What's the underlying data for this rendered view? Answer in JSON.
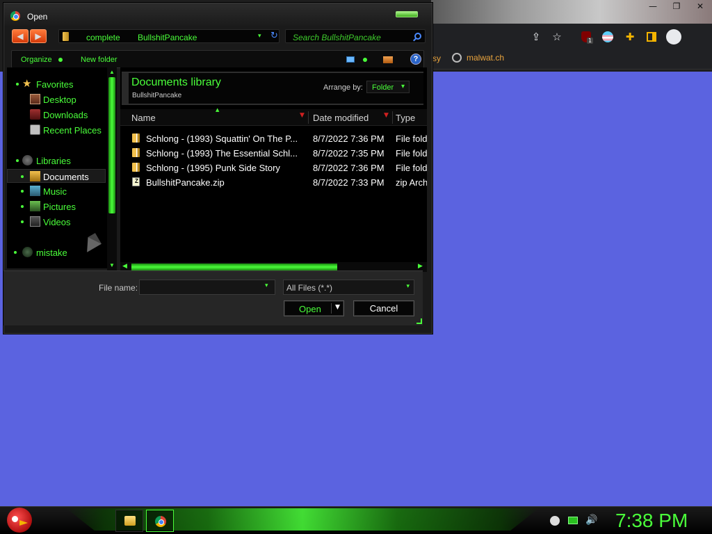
{
  "chrome": {
    "window_controls": {
      "minimize": "—",
      "maximize": "❐",
      "close": "✕"
    },
    "toolbar_icons": [
      "share-icon",
      "star-icon",
      "ublock-icon",
      "profile-switch-icon",
      "extensions-icon",
      "sidepanel-icon",
      "account-icon"
    ],
    "ublock_badge": "1",
    "bookmarks": {
      "partial_item": "sy",
      "malwatch": "malwat.ch"
    }
  },
  "dialog": {
    "title": "Open",
    "nav": {
      "back": "◀",
      "forward": "▶"
    },
    "address": {
      "crumbs": [
        "complete",
        "BullshitPancake"
      ],
      "dropdown_glyph": "▾",
      "refresh_glyph": "↻"
    },
    "search": {
      "placeholder": "Search BullshitPancake"
    },
    "commands": {
      "organize": "Organize",
      "new_folder": "New folder",
      "help": "?"
    },
    "nav_pane": {
      "favorites_label": "Favorites",
      "favorites": [
        "Desktop",
        "Downloads",
        "Recent Places"
      ],
      "libraries_label": "Libraries",
      "libraries": [
        "Documents",
        "Music",
        "Pictures",
        "Videos"
      ],
      "selected": "Documents",
      "user": "mistake"
    },
    "library_header": {
      "title": "Documents library",
      "subtitle": "BullshitPancake",
      "arrange_label": "Arrange by:",
      "arrange_value": "Folder"
    },
    "columns": {
      "name": "Name",
      "date": "Date modified",
      "type": "Type"
    },
    "files": [
      {
        "icon": "folder-icon",
        "name": "Schlong - (1993) Squattin' On The P...",
        "date": "8/7/2022 7:36 PM",
        "type": "File folder"
      },
      {
        "icon": "folder-icon",
        "name": "Schlong - (1993) The Essential Schl...",
        "date": "8/7/2022 7:35 PM",
        "type": "File folder"
      },
      {
        "icon": "folder-icon",
        "name": "Schlong - (1995) Punk Side Story",
        "date": "8/7/2022 7:36 PM",
        "type": "File folder"
      },
      {
        "icon": "zip-icon",
        "name": "BullshitPancake.zip",
        "date": "8/7/2022 7:33 PM",
        "type": "zip Archive"
      }
    ],
    "bottom": {
      "file_name_label": "File name:",
      "file_name_value": "",
      "filter": "All Files (*.*)",
      "open": "Open",
      "cancel": "Cancel"
    }
  },
  "taskbar": {
    "pinned": [
      "explorer-icon",
      "chrome-icon"
    ],
    "clock": "7:38 PM"
  },
  "colors": {
    "desktop": "#5b63e0",
    "accent_green": "#4aff3a",
    "bookmark_orange": "#e8a33d"
  }
}
